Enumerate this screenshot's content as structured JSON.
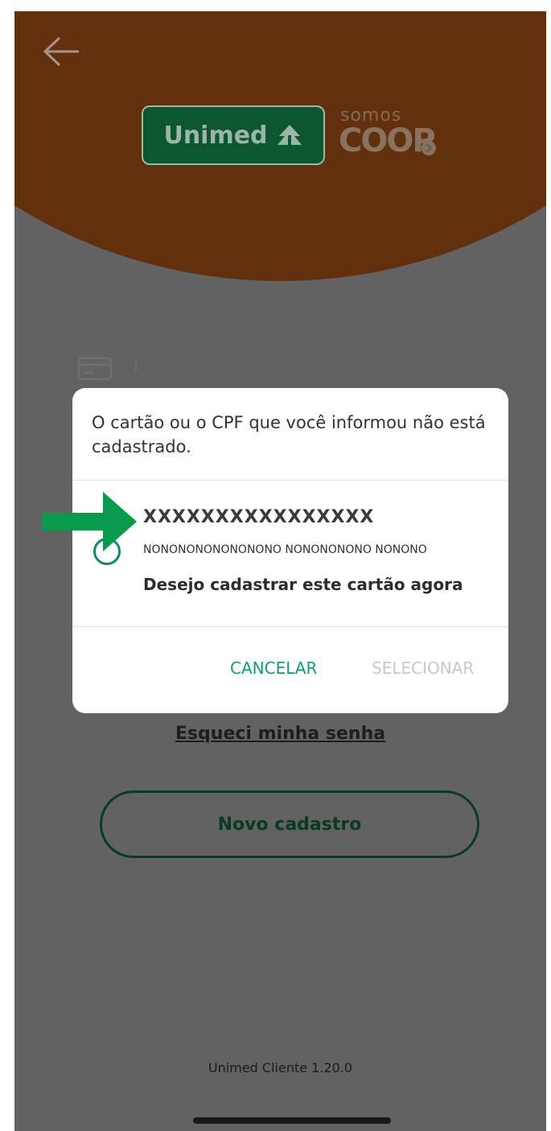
{
  "logo": {
    "brand": "Unimed",
    "somos": "somos",
    "coop": "COOP"
  },
  "login": {
    "forgot_password": "Esqueci minha senha",
    "new_registration": "Novo cadastro",
    "version": "Unimed Cliente 1.20.0"
  },
  "dialog": {
    "message": "O cartão ou o CPF que você informou não está cadastrado.",
    "option": {
      "card_number": "XXXXXXXXXXXXXXXX",
      "holder_name": "NONONONONONONONO NONONONONO NONONO",
      "action": "Desejo cadastrar este cartão agora",
      "selected": false
    },
    "cancel_label": "CANCELAR",
    "select_label": "SELECIONAR"
  },
  "colors": {
    "header": "#63300e",
    "overlay": "#626262",
    "brand_green": "#0c5630",
    "accent_green": "#11a06a",
    "arrow_green": "#0a9a4e"
  },
  "icons": [
    "back-arrow-icon",
    "unimed-tree-icon",
    "card-icon",
    "arrow-pointer-icon"
  ]
}
